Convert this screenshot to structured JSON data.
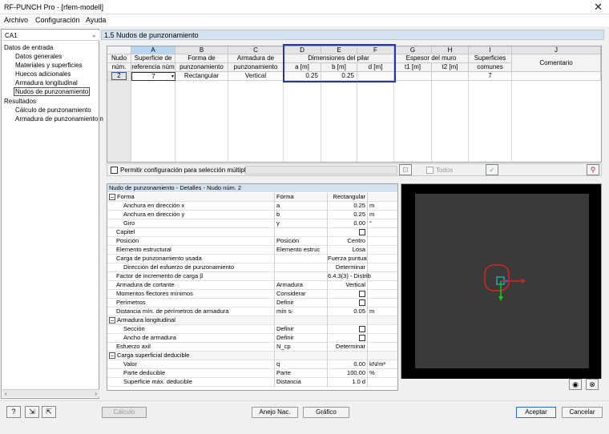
{
  "window": {
    "title": "RF-PUNCH Pro - [rfem-modell]"
  },
  "menu": [
    "Archivo",
    "Configuración",
    "Ayuda"
  ],
  "case_selector": {
    "value": "CA1"
  },
  "tree": {
    "input_label": "Datos de entrada",
    "input_items": [
      "Datos generales",
      "Materiales y superficies",
      "Huecos adicionales",
      "Armadura longitudinal",
      "Nudos de punzonamiento"
    ],
    "results_label": "Resultados",
    "result_items": [
      "Cálculo de punzonamiento",
      "Armadura de punzonamiento n"
    ]
  },
  "section_title": "1.5 Nudos de punzonamiento",
  "grid": {
    "letters": [
      "A",
      "B",
      "C",
      "D",
      "E",
      "F",
      "G",
      "H",
      "I",
      "J"
    ],
    "node_header": [
      "Nudo",
      "núm."
    ],
    "headers": [
      [
        "Superficie de",
        "referencia núm"
      ],
      [
        "Forma de",
        "punzonamiento"
      ],
      [
        "Armadura de",
        "punzonamiento"
      ],
      [
        "Dimensiones del pilar",
        "a [m]",
        "b [m]",
        "d [m]"
      ],
      [
        "Espesor del muro",
        "t1 [m]",
        "t2 [m]"
      ],
      [
        "Superficies",
        "comunes"
      ],
      [
        "Comentario"
      ]
    ],
    "row": {
      "node": "2",
      "surface": "7",
      "form": "Rectangular",
      "reinforcement": "Vertical",
      "a": "0.25",
      "b": "0.25",
      "common": "7"
    }
  },
  "options": {
    "multi_label": "Permitir configuración para selección múltiple:",
    "all_label": "Todos"
  },
  "details": {
    "title": "Nudo de punzonamiento - Detalles - Nudo núm. 2",
    "rows": [
      {
        "label": "Forma",
        "sym": "Forma",
        "val": "Rectangular",
        "unit": "",
        "indent": 0,
        "toggle": "−"
      },
      {
        "label": "Anchura en dirección x",
        "sym": "a",
        "val": "0.25",
        "unit": "m",
        "indent": 2
      },
      {
        "label": "Anchura en dirección y",
        "sym": "b",
        "val": "0.25",
        "unit": "m",
        "indent": 2
      },
      {
        "label": "Giro",
        "sym": "γ",
        "val": "0.00",
        "unit": "°",
        "indent": 2
      },
      {
        "label": "Capitel",
        "sym": "",
        "val": "",
        "unit": "",
        "indent": 1,
        "check": true
      },
      {
        "label": "Posición",
        "sym": "Posición",
        "val": "Centro",
        "unit": "",
        "indent": 1
      },
      {
        "label": "Elemento estructural",
        "sym": "Elemento estruc",
        "val": "Losa",
        "unit": "",
        "indent": 1
      },
      {
        "label": "Carga de punzonamiento usada",
        "sym": "",
        "val": "Fuerza puntual",
        "unit": "",
        "indent": 1
      },
      {
        "label": "Dirección del esfuerzo de punzonamiento",
        "sym": "",
        "val": "Determinar",
        "unit": "",
        "indent": 2
      },
      {
        "label": "Factor de incremento de carga β",
        "sym": "",
        "val": "6.4.3(3) - Distrib",
        "unit": "",
        "indent": 1
      },
      {
        "label": "Armadura de cortante",
        "sym": "Armadura",
        "val": "Vertical",
        "unit": "",
        "indent": 1
      },
      {
        "label": "Momentos flectores mínimos",
        "sym": "Considerar",
        "val": "",
        "unit": "",
        "indent": 1,
        "check": true
      },
      {
        "label": "Perímetros",
        "sym": "Definir",
        "val": "",
        "unit": "",
        "indent": 1,
        "check": true
      },
      {
        "label": "Distancia mín. de perímetros de armadura",
        "sym": "mín sᵣ",
        "val": "0.05",
        "unit": "m",
        "indent": 1
      },
      {
        "label": "Armadura longitudinal",
        "sym": "",
        "val": "",
        "unit": "",
        "indent": 0,
        "toggle": "−"
      },
      {
        "label": "Sección",
        "sym": "Definir",
        "val": "",
        "unit": "",
        "indent": 2,
        "check": true
      },
      {
        "label": "Ancho de armadura",
        "sym": "Definir",
        "val": "",
        "unit": "",
        "indent": 2,
        "check": true
      },
      {
        "label": "Esfuerzo axil",
        "sym": "N_cp",
        "val": "Determinar",
        "unit": "",
        "indent": 1
      },
      {
        "label": "Carga superficial deducible",
        "sym": "",
        "val": "",
        "unit": "",
        "indent": 0,
        "toggle": "−"
      },
      {
        "label": "Valor",
        "sym": "q",
        "val": "0.00",
        "unit": "kN/m²",
        "indent": 2
      },
      {
        "label": "Parte deducible",
        "sym": "Parte",
        "val": "100.00",
        "unit": "%",
        "indent": 2
      },
      {
        "label": "Superficie máx. deducible",
        "sym": "Distancia",
        "val": "1.0 d",
        "unit": "",
        "indent": 2
      }
    ]
  },
  "buttons": {
    "calculo": "Cálculo",
    "anejo": "Anejo Nac.",
    "grafico": "Gráfico",
    "aceptar": "Aceptar",
    "cancelar": "Cancelar"
  },
  "colors": {
    "header_bg": "#d5e3f0",
    "selection": "#2236b0",
    "punch_outline": "#e02020",
    "axis_x": "#e02020",
    "axis_y": "#20c020",
    "column": "#20a0a0"
  }
}
